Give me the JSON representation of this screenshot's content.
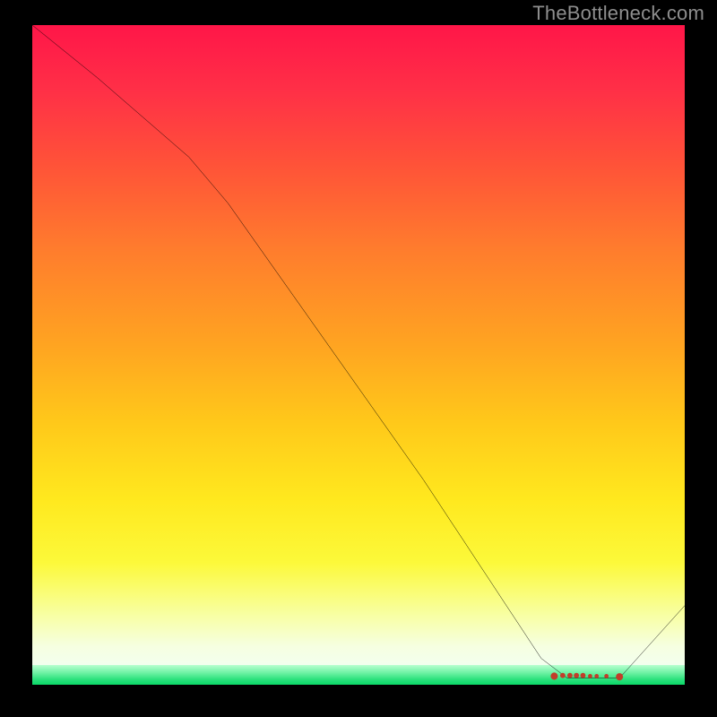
{
  "watermark": "TheBottleneck.com",
  "colors": {
    "background": "#000000",
    "gradient_top": "#ff1648",
    "gradient_mid": "#ffd21a",
    "gradient_bottom_yellow": "#f6ffe0",
    "gradient_green": "#0bd968",
    "curve": "#000000",
    "watermark_text": "#8e8e8e"
  },
  "chart_data": {
    "type": "line",
    "title": "",
    "xlabel": "",
    "ylabel": "",
    "xlim": [
      0,
      100
    ],
    "ylim": [
      0,
      100
    ],
    "series": [
      {
        "name": "bottleneck-curve",
        "x": [
          0,
          10,
          24,
          30,
          40,
          50,
          60,
          70,
          78,
          82,
          86,
          90,
          100
        ],
        "values": [
          100,
          92,
          80,
          73,
          59,
          45,
          31,
          16,
          4,
          1,
          1,
          1,
          12
        ]
      }
    ],
    "annotations": [
      {
        "name": "optimum-range",
        "x_start": 80,
        "x_end": 90,
        "y": 1
      }
    ],
    "grid": false,
    "legend": false
  }
}
